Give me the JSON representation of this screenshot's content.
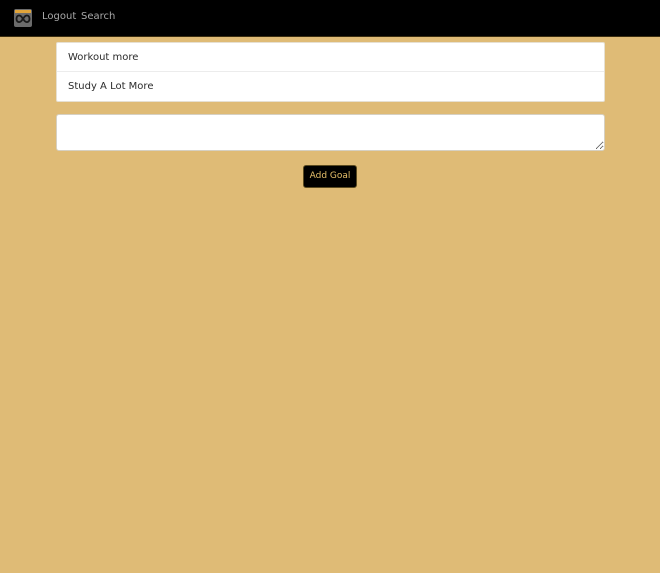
{
  "navbar": {
    "brand_icon": "infinity-logo-icon",
    "links": {
      "logout": "Logout",
      "search": "Search"
    },
    "colors": {
      "background": "#000000",
      "link": "#a8a8a8"
    }
  },
  "goals": [
    {
      "text": "Workout more"
    },
    {
      "text": "Study A Lot More"
    }
  ],
  "new_goal": {
    "value": "",
    "placeholder": ""
  },
  "add_button": {
    "label": "Add Goal"
  },
  "colors": {
    "page_background": "#dfbb76",
    "button_text": "#e6bf6a"
  }
}
